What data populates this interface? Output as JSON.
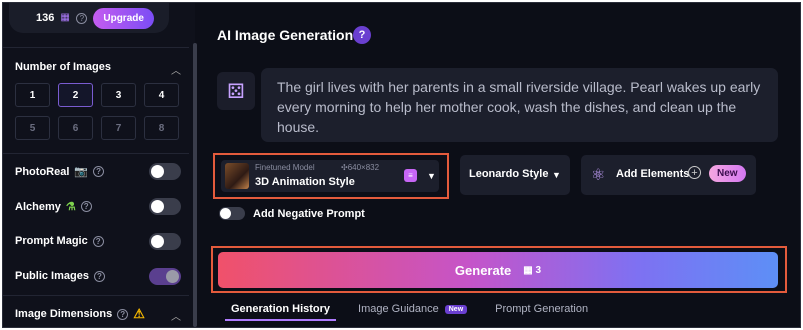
{
  "sidebar": {
    "tokens": {
      "count": "136",
      "help": "?",
      "upgrade_label": "Upgrade"
    },
    "num_images": {
      "title": "Number of Images",
      "options": [
        "1",
        "2",
        "3",
        "4",
        "5",
        "6",
        "7",
        "8"
      ],
      "selected": "2"
    },
    "photoreal": {
      "label": "PhotoReal",
      "enabled": false
    },
    "alchemy": {
      "label": "Alchemy",
      "enabled": false
    },
    "prompt_magic": {
      "label": "Prompt Magic",
      "enabled": false
    },
    "public_images": {
      "label": "Public Images",
      "enabled": true
    },
    "image_dimensions": {
      "label": "Image Dimensions"
    }
  },
  "main": {
    "title": "AI Image Generation",
    "help_badge": "?",
    "prompt_text": "The girl lives with her parents in a small riverside village. Pearl wakes up early every morning to help her mother cook, wash the dishes, and clean up the house.",
    "model": {
      "caption": "Finetuned Model",
      "dimensions": "640×832",
      "name": "3D Animation Style"
    },
    "style_label": "Leonardo Style",
    "add_elements_label": "Add Elements",
    "new_pill": "New",
    "negative_prompt_label": "Add Negative Prompt",
    "generate_label": "Generate",
    "generate_cost": "3",
    "tabs": [
      {
        "label": "Generation History",
        "active": true
      },
      {
        "label": "Image Guidance",
        "badge": "New"
      },
      {
        "label": "Prompt Generation"
      }
    ]
  },
  "colors": {
    "accent": "#7a5cd1",
    "highlight_border": "#e45b3c",
    "background": "#0c0e17"
  }
}
